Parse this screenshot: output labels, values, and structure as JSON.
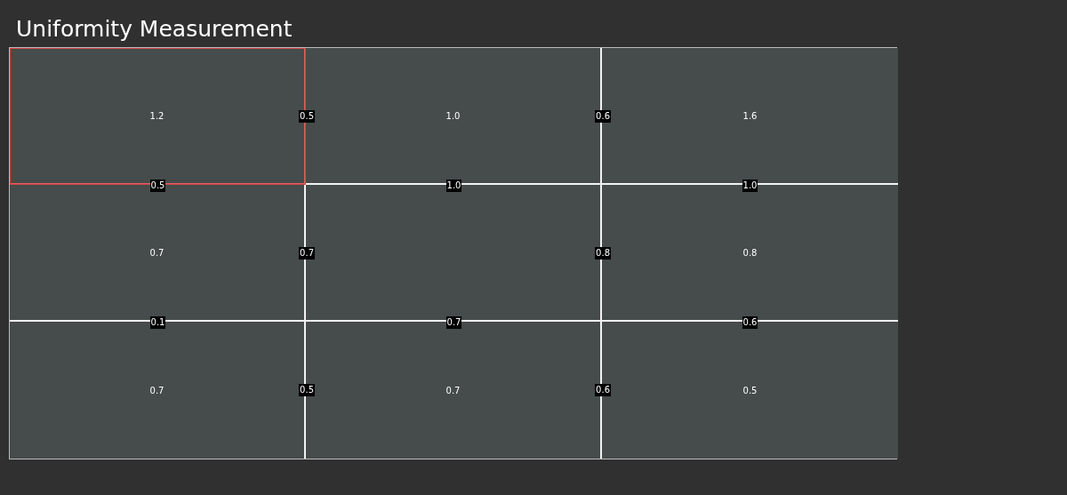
{
  "title": "Uniformity Measurement",
  "rows": [
    {
      "cells": [
        {
          "value": "1.2",
          "selected": true,
          "right_diff": "0.5",
          "bottom_diff": "0.5"
        },
        {
          "value": "1.0",
          "selected": false,
          "right_diff": "0.6",
          "bottom_diff": "1.0"
        },
        {
          "value": "1.6",
          "selected": false,
          "bottom_diff": "1.0"
        }
      ]
    },
    {
      "cells": [
        {
          "value": "0.7",
          "selected": false,
          "right_diff": "0.7",
          "bottom_diff": "0.1"
        },
        {
          "selected": false,
          "right_diff": "0.8",
          "bottom_diff": "0.7"
        },
        {
          "value": "0.8",
          "selected": false,
          "bottom_diff": "0.6"
        }
      ]
    },
    {
      "cells": [
        {
          "value": "0.7",
          "selected": false,
          "right_diff": "0.5"
        },
        {
          "value": "0.7",
          "selected": false,
          "right_diff": "0.6"
        },
        {
          "value": "0.5",
          "selected": false
        }
      ]
    }
  ]
}
